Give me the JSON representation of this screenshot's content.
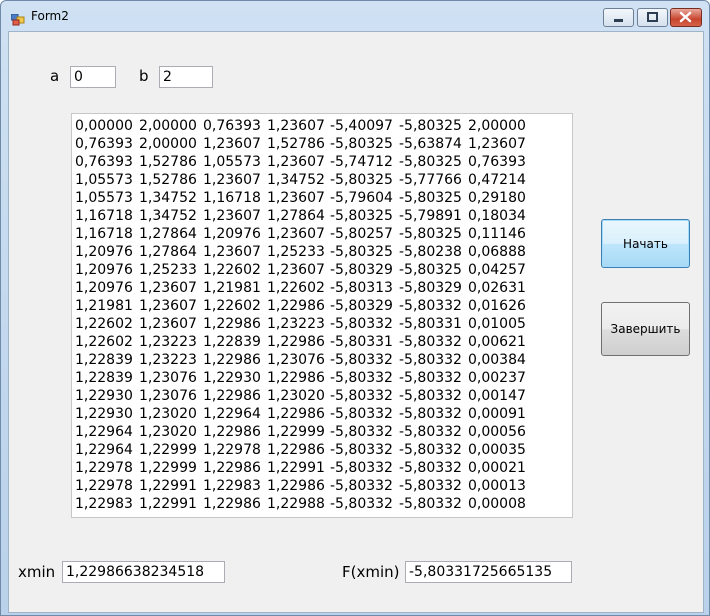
{
  "window": {
    "title": "Form2"
  },
  "inputs": {
    "a_label": "a",
    "a_value": "0",
    "b_label": "b",
    "b_value": "2"
  },
  "table": {
    "rows": [
      [
        "0,00000",
        "2,00000",
        "0,76393",
        "1,23607",
        "-5,40097",
        "-5,80325",
        "2,00000"
      ],
      [
        "0,76393",
        "2,00000",
        "1,23607",
        "1,52786",
        "-5,80325",
        "-5,63874",
        "1,23607"
      ],
      [
        "0,76393",
        "1,52786",
        "1,05573",
        "1,23607",
        "-5,74712",
        "-5,80325",
        "0,76393"
      ],
      [
        "1,05573",
        "1,52786",
        "1,23607",
        "1,34752",
        "-5,80325",
        "-5,77766",
        "0,47214"
      ],
      [
        "1,05573",
        "1,34752",
        "1,16718",
        "1,23607",
        "-5,79604",
        "-5,80325",
        "0,29180"
      ],
      [
        "1,16718",
        "1,34752",
        "1,23607",
        "1,27864",
        "-5,80325",
        "-5,79891",
        "0,18034"
      ],
      [
        "1,16718",
        "1,27864",
        "1,20976",
        "1,23607",
        "-5,80257",
        "-5,80325",
        "0,11146"
      ],
      [
        "1,20976",
        "1,27864",
        "1,23607",
        "1,25233",
        "-5,80325",
        "-5,80238",
        "0,06888"
      ],
      [
        "1,20976",
        "1,25233",
        "1,22602",
        "1,23607",
        "-5,80329",
        "-5,80325",
        "0,04257"
      ],
      [
        "1,20976",
        "1,23607",
        "1,21981",
        "1,22602",
        "-5,80313",
        "-5,80329",
        "0,02631"
      ],
      [
        "1,21981",
        "1,23607",
        "1,22602",
        "1,22986",
        "-5,80329",
        "-5,80332",
        "0,01626"
      ],
      [
        "1,22602",
        "1,23607",
        "1,22986",
        "1,23223",
        "-5,80332",
        "-5,80331",
        "0,01005"
      ],
      [
        "1,22602",
        "1,23223",
        "1,22839",
        "1,22986",
        "-5,80331",
        "-5,80332",
        "0,00621"
      ],
      [
        "1,22839",
        "1,23223",
        "1,22986",
        "1,23076",
        "-5,80332",
        "-5,80332",
        "0,00384"
      ],
      [
        "1,22839",
        "1,23076",
        "1,22930",
        "1,22986",
        "-5,80332",
        "-5,80332",
        "0,00237"
      ],
      [
        "1,22930",
        "1,23076",
        "1,22986",
        "1,23020",
        "-5,80332",
        "-5,80332",
        "0,00147"
      ],
      [
        "1,22930",
        "1,23020",
        "1,22964",
        "1,22986",
        "-5,80332",
        "-5,80332",
        "0,00091"
      ],
      [
        "1,22964",
        "1,23020",
        "1,22986",
        "1,22999",
        "-5,80332",
        "-5,80332",
        "0,00056"
      ],
      [
        "1,22964",
        "1,22999",
        "1,22978",
        "1,22986",
        "-5,80332",
        "-5,80332",
        "0,00035"
      ],
      [
        "1,22978",
        "1,22999",
        "1,22986",
        "1,22991",
        "-5,80332",
        "-5,80332",
        "0,00021"
      ],
      [
        "1,22978",
        "1,22991",
        "1,22983",
        "1,22986",
        "-5,80332",
        "-5,80332",
        "0,00013"
      ],
      [
        "1,22983",
        "1,22991",
        "1,22986",
        "1,22988",
        "-5,80332",
        "-5,80332",
        "0,00008"
      ]
    ]
  },
  "buttons": {
    "start": "Начать",
    "finish": "Завершить"
  },
  "results": {
    "xmin_label": "xmin",
    "xmin_value": "1,22986638234518",
    "fxmin_label": "F(xmin)",
    "fxmin_value": "-5,80331725665135"
  }
}
